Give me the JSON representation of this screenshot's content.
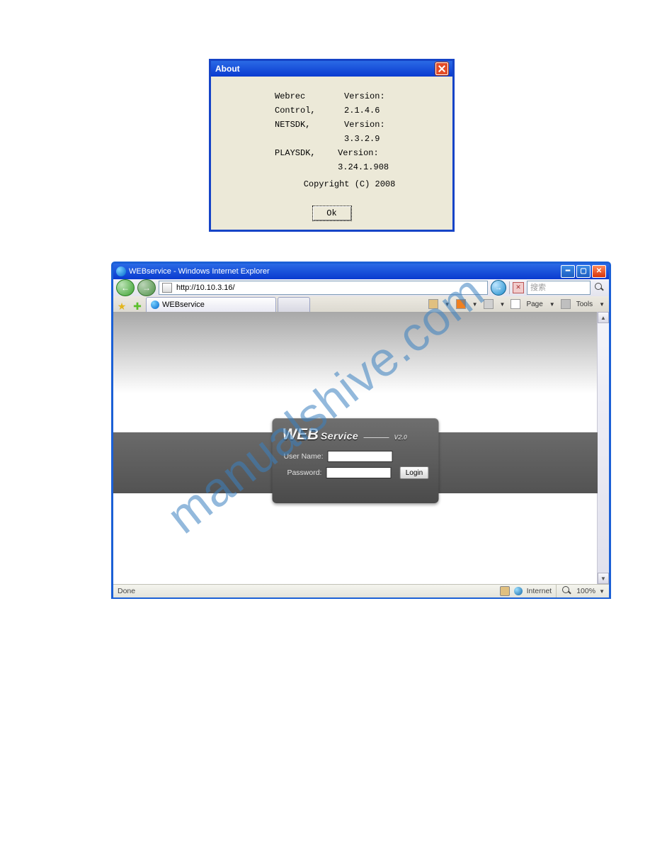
{
  "about": {
    "title": "About",
    "rows": [
      {
        "k": "Webrec Control,",
        "v": "Version: 2.1.4.6"
      },
      {
        "k": "NETSDK,",
        "v": "Version: 3.3.2.9"
      },
      {
        "k": "PLAYSDK,",
        "v": "Version: 3.24.1.908"
      }
    ],
    "copyright": "Copyright (C) 2008",
    "ok": "Ok"
  },
  "browser": {
    "title": "WEBservice - Windows Internet Explorer",
    "url": "http://10.10.3.16/",
    "search_placeholder": "搜索",
    "tab": {
      "label": "WEBservice"
    },
    "toolbar_items": [
      "Page",
      "Tools"
    ],
    "status_left": "Done",
    "status_zone": "Internet",
    "zoom": "100%"
  },
  "login": {
    "title_big": "WEB",
    "title_mid": "Service",
    "title_ver": "V2.0",
    "user_label": "User Name:",
    "pass_label": "Password:",
    "button": "Login"
  },
  "watermark": "manualshive.com"
}
